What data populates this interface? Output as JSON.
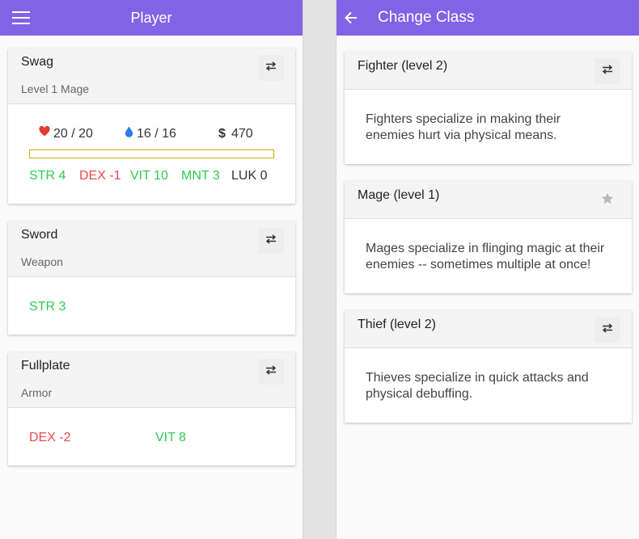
{
  "player_panel": {
    "title": "Player",
    "character": {
      "name": "Swag",
      "subtitle": "Level 1 Mage",
      "hp": "20 / 20",
      "mp": "16 / 16",
      "gold": "470",
      "xp_progress": 0,
      "stats": [
        {
          "label": "STR 4",
          "tone": "green"
        },
        {
          "label": "DEX -1",
          "tone": "red"
        },
        {
          "label": "VIT 10",
          "tone": "green"
        },
        {
          "label": "MNT 3",
          "tone": "green"
        },
        {
          "label": "LUK 0",
          "tone": "dark"
        }
      ]
    },
    "weapon": {
      "name": "Sword",
      "type": "Weapon",
      "stats": [
        {
          "label": "STR 3",
          "tone": "green"
        }
      ]
    },
    "armor": {
      "name": "Fullplate",
      "type": "Armor",
      "stats": [
        {
          "label": "DEX -2",
          "tone": "red"
        },
        {
          "label": "VIT 8",
          "tone": "green"
        }
      ]
    }
  },
  "class_panel": {
    "title": "Change Class",
    "classes": [
      {
        "name": "Fighter (level 2)",
        "desc_line1": "Fighters specialize in making their",
        "desc_line2": "enemies hurt via physical means.",
        "action_icon": "swap-icon"
      },
      {
        "name": "Mage (level 1)",
        "desc_line1": "Mages specialize in flinging magic at their",
        "desc_line2": "enemies -- sometimes multiple at once!",
        "action_icon": "star-icon"
      },
      {
        "name": "Thief (level 2)",
        "desc_line1": "Thieves specialize in quick attacks and",
        "desc_line2": "physical debuffing.",
        "action_icon": "swap-icon"
      }
    ]
  },
  "colors": {
    "appbar": "#8163e6",
    "positive": "#2ecc52",
    "negative": "#e84a4a",
    "heart": "#e53935",
    "drop": "#2b7de9",
    "xp_bar_border": "#c8b400"
  }
}
